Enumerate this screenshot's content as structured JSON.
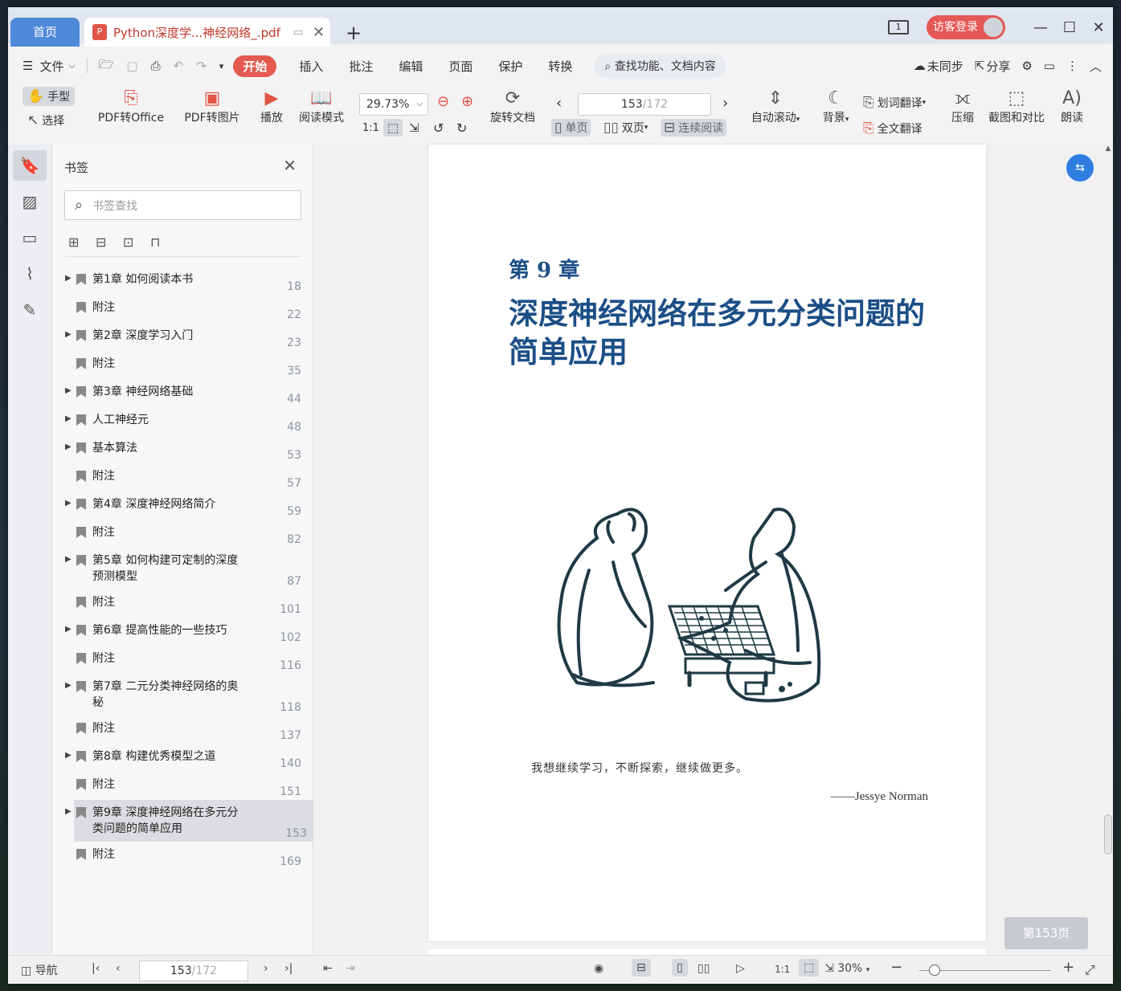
{
  "tabs": {
    "home": "首页",
    "doc_title": "Python深度学...神经网络_.pdf",
    "pdf_icon": "P",
    "new_tab": "+"
  },
  "title_right": {
    "window_mode": "1",
    "login": "访客登录",
    "minimize": "—",
    "maximize": "☐",
    "close": "✕"
  },
  "menu": {
    "file": "文件",
    "items": [
      "开始",
      "插入",
      "批注",
      "编辑",
      "页面",
      "保护",
      "转换"
    ],
    "search": "查找功能、文档内容",
    "sync": "未同步",
    "share": "分享"
  },
  "toolbar": {
    "hand": "手型",
    "select": "选择",
    "pdf_to_office": "PDF转Office",
    "pdf_to_image": "PDF转图片",
    "play": "播放",
    "read_mode": "阅读模式",
    "zoom": "29.73%",
    "rotate": "旋转文档",
    "page_current": "153",
    "page_total": "/172",
    "single": "单页",
    "double": "双页",
    "continuous": "连续阅读",
    "auto_scroll": "自动滚动",
    "background": "背景",
    "word_translate": "划词翻译",
    "full_translate": "全文翻译",
    "compress": "压缩",
    "screenshot": "截图和对比",
    "read_aloud": "朗读"
  },
  "bookmarks": {
    "title": "书签",
    "search_placeholder": "书签查找",
    "items": [
      {
        "label": "第1章 如何阅读本书",
        "page": "18",
        "expand": true
      },
      {
        "label": "附注",
        "page": "22",
        "expand": false
      },
      {
        "label": "第2章 深度学习入门",
        "page": "23",
        "expand": true
      },
      {
        "label": "附注",
        "page": "35",
        "expand": false
      },
      {
        "label": "第3章 神经网络基础",
        "page": "44",
        "expand": true
      },
      {
        "label": "人工神经元",
        "page": "48",
        "expand": true
      },
      {
        "label": "基本算法",
        "page": "53",
        "expand": true
      },
      {
        "label": "附注",
        "page": "57",
        "expand": false
      },
      {
        "label": "第4章 深度神经网络简介",
        "page": "59",
        "expand": true
      },
      {
        "label": "附注",
        "page": "82",
        "expand": false
      },
      {
        "label": "第5章 如何构建可定制的深度预测模型",
        "page": "87",
        "expand": true
      },
      {
        "label": "附注",
        "page": "101",
        "expand": false
      },
      {
        "label": "第6章 提高性能的一些技巧",
        "page": "102",
        "expand": true
      },
      {
        "label": "附注",
        "page": "116",
        "expand": false
      },
      {
        "label": "第7章 二元分类神经网络的奥秘",
        "page": "118",
        "expand": true
      },
      {
        "label": "附注",
        "page": "137",
        "expand": false
      },
      {
        "label": "第8章 构建优秀模型之道",
        "page": "140",
        "expand": true
      },
      {
        "label": "附注",
        "page": "151",
        "expand": false
      },
      {
        "label": "第9章 深度神经网络在多元分类问题的简单应用",
        "page": "153",
        "expand": true,
        "selected": true
      },
      {
        "label": "附注",
        "page": "169",
        "expand": false
      }
    ]
  },
  "document": {
    "chapter_no": "第 9 章",
    "chapter_title": "深度神经网络在多元分类问题的简单应用",
    "quote": "我想继续学习，不断探索，继续做更多。",
    "author": "——Jessye Norman",
    "page_badge": "第153页"
  },
  "statusbar": {
    "nav": "导航",
    "page_current": "153",
    "page_total": "/172",
    "zoom": "30%"
  }
}
